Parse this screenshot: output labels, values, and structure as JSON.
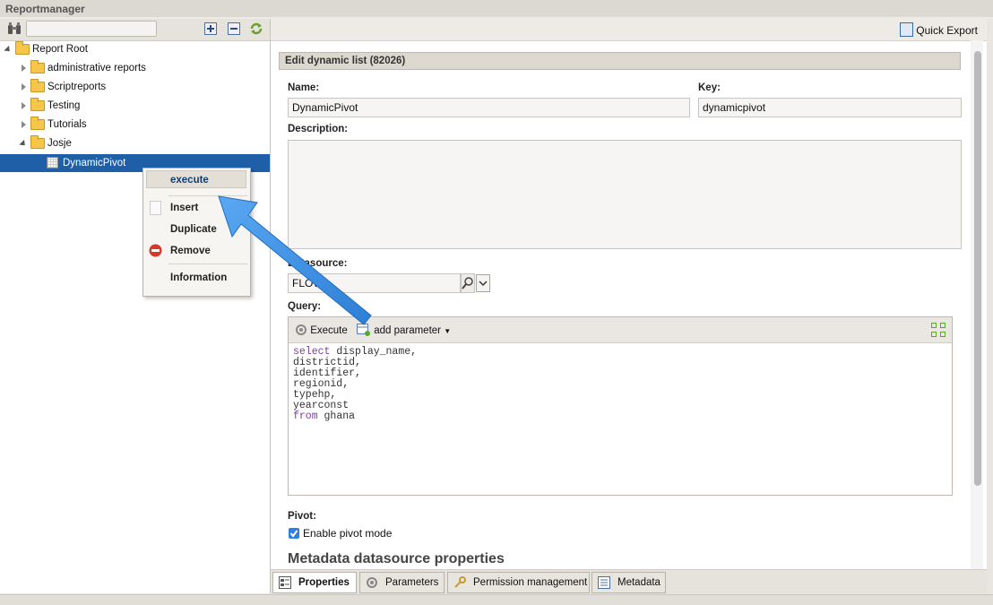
{
  "app": {
    "title": "Reportmanager"
  },
  "left": {
    "search_placeholder": "",
    "tree": [
      {
        "label": "Report Root",
        "level": 0,
        "expanded": true,
        "icon": "folder-open-icon"
      },
      {
        "label": "administrative reports",
        "level": 1,
        "expanded": false,
        "icon": "folder-icon"
      },
      {
        "label": "Scriptreports",
        "level": 1,
        "expanded": false,
        "icon": "folder-icon"
      },
      {
        "label": "Testing",
        "level": 1,
        "expanded": false,
        "icon": "folder-icon"
      },
      {
        "label": "Tutorials",
        "level": 1,
        "expanded": false,
        "icon": "folder-icon"
      },
      {
        "label": "Josje",
        "level": 1,
        "expanded": true,
        "icon": "folder-open-icon"
      },
      {
        "label": "DynamicPivot",
        "level": 2,
        "selected": true,
        "icon": "table-icon"
      }
    ]
  },
  "context_menu": {
    "items": [
      {
        "label": "execute",
        "enabled": true,
        "highlighted": true
      },
      {
        "label": "Insert",
        "enabled": false
      },
      {
        "label": "Duplicate",
        "enabled": true
      },
      {
        "label": "Remove",
        "enabled": true,
        "icon": "remove-icon"
      },
      {
        "label": "Information",
        "enabled": true
      }
    ]
  },
  "right": {
    "toolbar": {
      "quick_export_label": "Quick Export"
    },
    "section_title": "Edit dynamic list (82026)",
    "name_label": "Name:",
    "name_value": "DynamicPivot",
    "key_label": "Key:",
    "key_value": "dynamicpivot",
    "description_label": "Description:",
    "description_value": "",
    "datasource_label": "Datasource:",
    "datasource_value": "FLOW",
    "query_label": "Query:",
    "query_toolbar": {
      "execute_label": "Execute",
      "add_parameter_label": "add parameter"
    },
    "query_lines": [
      {
        "kw": "select",
        "rest": " display_name,"
      },
      {
        "kw": "",
        "rest": "districtid,"
      },
      {
        "kw": "",
        "rest": "identifier,"
      },
      {
        "kw": "",
        "rest": "regionid,"
      },
      {
        "kw": "",
        "rest": "typehp,"
      },
      {
        "kw": "",
        "rest": "yearconst"
      },
      {
        "kw": "from",
        "rest": " ghana"
      }
    ],
    "pivot_label": "Pivot:",
    "pivot_checkbox_label": "Enable pivot mode",
    "pivot_enabled": true,
    "metadata_heading": "Metadata datasource properties"
  },
  "tabs": [
    {
      "label": "Properties",
      "active": true,
      "icon": "properties-icon"
    },
    {
      "label": "Parameters",
      "active": false,
      "icon": "gear-icon"
    },
    {
      "label": "Permission management",
      "active": false,
      "icon": "key-icon"
    },
    {
      "label": "Metadata",
      "active": false,
      "icon": "metadata-icon"
    }
  ],
  "colors": {
    "selection": "#1e5fa8",
    "arrow": "#3a8ee6",
    "keyword": "#7b3d9e"
  }
}
